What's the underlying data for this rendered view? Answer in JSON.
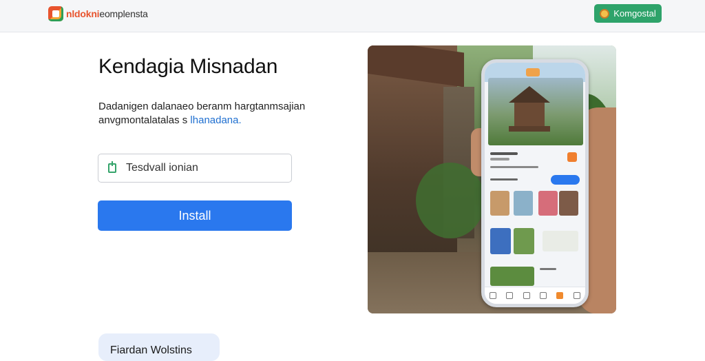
{
  "header": {
    "brand_part1": "nldokni",
    "brand_part2": "eomplensta",
    "action_label": "Komgostal"
  },
  "main": {
    "title": "Kendagia Misnadan",
    "description_line1": "Dadanigen dalanaeo beranm hargtanmsajian",
    "description_line2_prefix": "anvgmontalatalas s ",
    "description_link": "lhanadana.",
    "search_value": "Tesdvall ionian",
    "install_label": "Install",
    "bottom_card_label": "Fiardan Wolstins"
  },
  "colors": {
    "install_button": "#2a78ee",
    "header_button": "#2ea36a",
    "link": "#1f6fd0"
  }
}
